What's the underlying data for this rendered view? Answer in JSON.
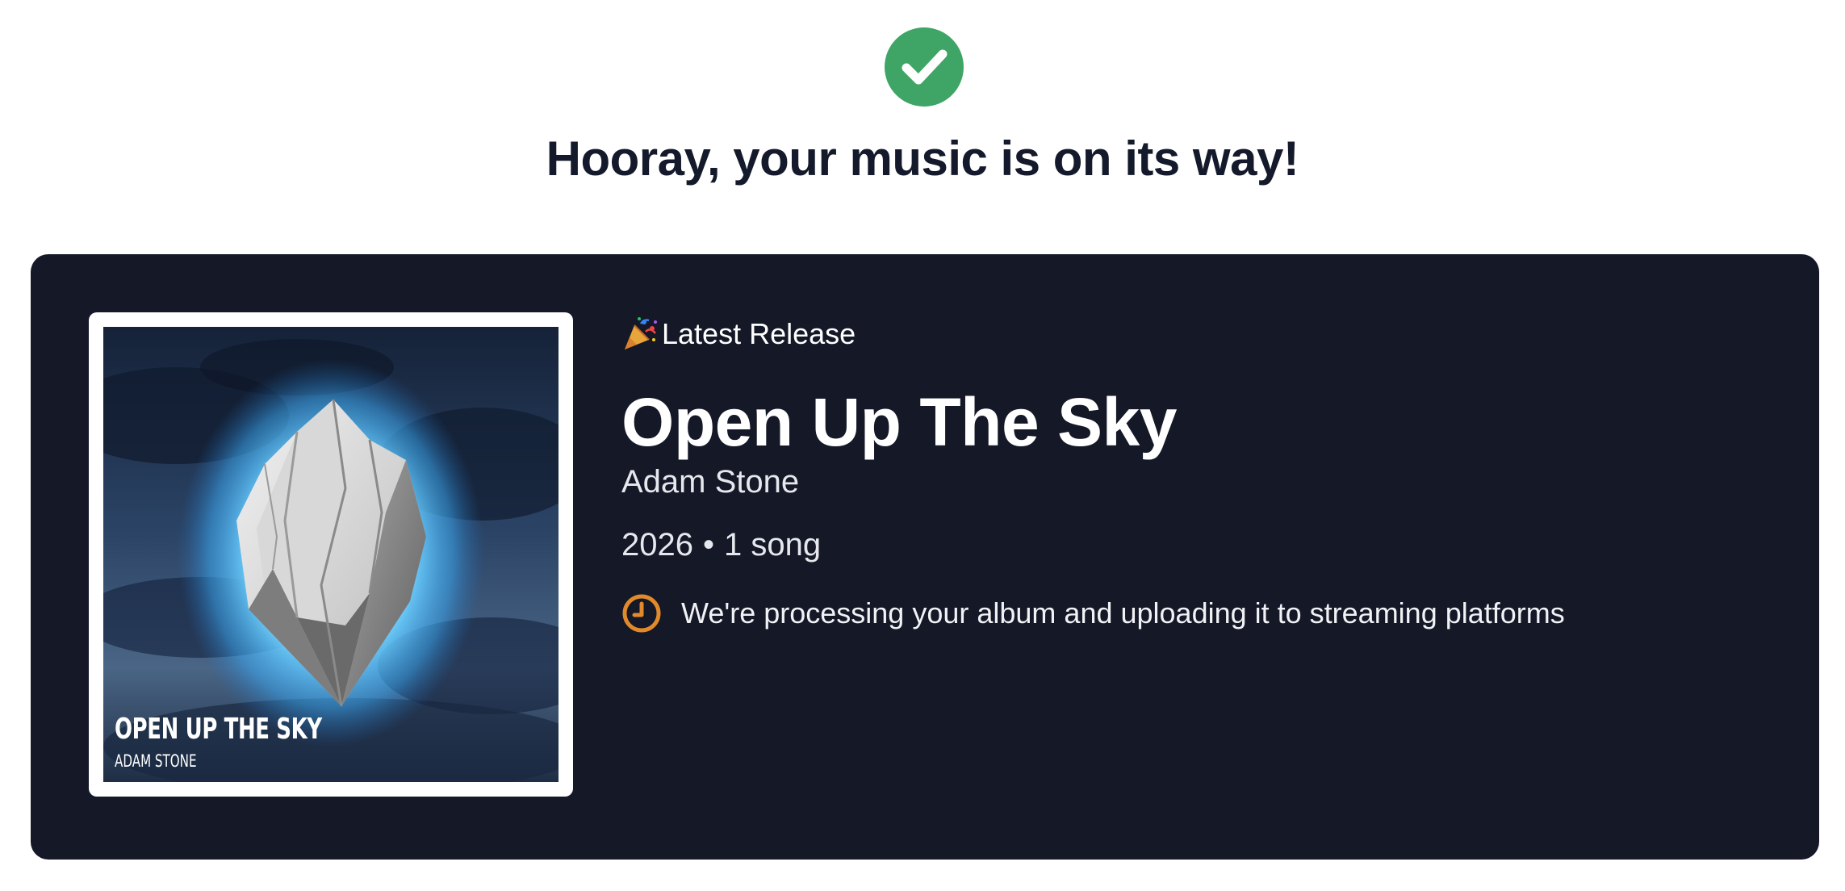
{
  "headline": "Hooray, your music is on its way!",
  "colors": {
    "success": "#3fa566",
    "card_background": "#141827",
    "clock_accent": "#e08a2c",
    "headline": "#141a2b"
  },
  "release": {
    "eyebrow_icon": "party-popper-icon",
    "eyebrow": "Latest Release",
    "title": "Open Up The Sky",
    "artist": "Adam Stone",
    "year": "2026",
    "separator": "•",
    "song_count": "1 song",
    "status_icon": "clock-icon",
    "status": "We're processing your album and uploading it to streaming platforms"
  },
  "cover_art": {
    "title_text": "OPEN UP THE SKY",
    "artist_text": "ADAM STONE"
  }
}
